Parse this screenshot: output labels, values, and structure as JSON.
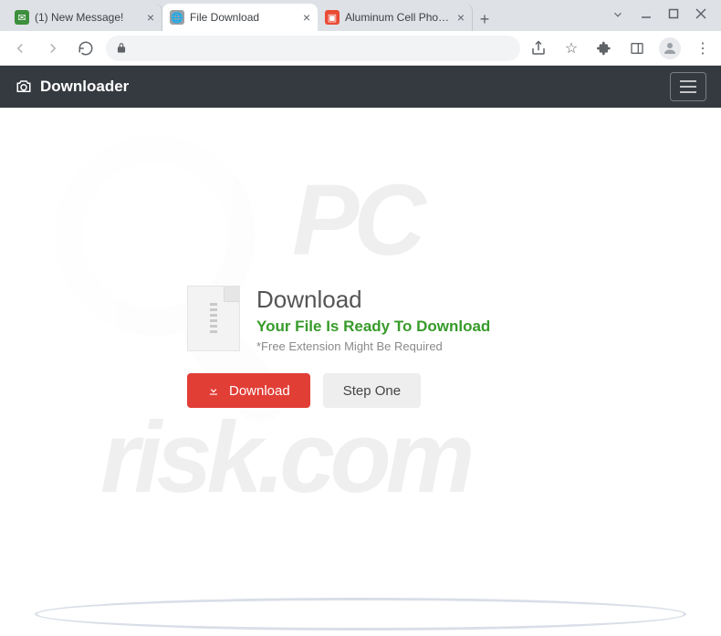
{
  "tabs": [
    {
      "title": "(1) New Message!"
    },
    {
      "title": "File Download"
    },
    {
      "title": "Aluminum Cell Phone H"
    }
  ],
  "brand": "Downloader",
  "download_title": "Download",
  "download_ready": "Your File Is Ready To Download",
  "download_note": "*Free Extension Might Be Required",
  "btn_download": "Download",
  "btn_step": "Step One"
}
